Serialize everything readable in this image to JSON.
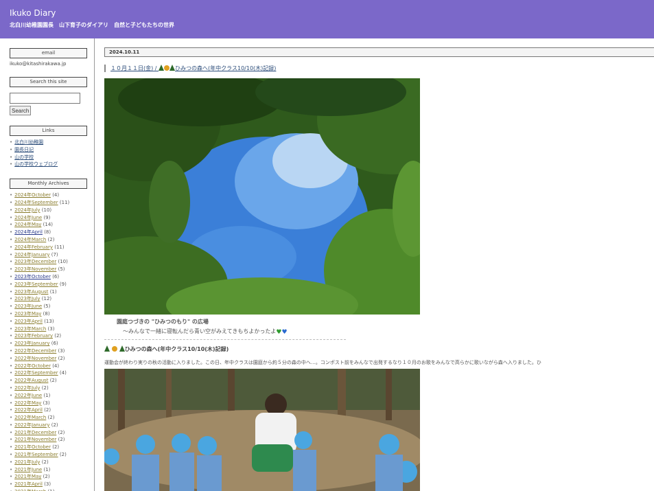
{
  "header": {
    "title": "Ikuko Diary",
    "description": "北白川幼稚園園長　山下育子のダイアリ　自然と子どもたちの世界"
  },
  "sidebar": {
    "email_title": "email",
    "email_value": "ikuko@kitashirakawa.jp",
    "search_title": "Search this site",
    "search_value": "",
    "search_button": "Search",
    "links_title": "Links",
    "links": [
      "北白川幼稚園",
      "園長日記",
      "山の学校",
      "山の学校ウェブログ"
    ],
    "archives_title": "Monthly Archives",
    "archives": [
      {
        "label": "2024年October",
        "count": "(4)"
      },
      {
        "label": "2024年September",
        "count": "(11)"
      },
      {
        "label": "2024年July",
        "count": "(10)"
      },
      {
        "label": "2024年June",
        "count": "(9)"
      },
      {
        "label": "2024年May",
        "count": "(14)"
      },
      {
        "label": "2024年April",
        "count": "(8)"
      },
      {
        "label": "2024年March",
        "count": "(2)"
      },
      {
        "label": "2024年February",
        "count": "(11)"
      },
      {
        "label": "2024年January",
        "count": "(7)"
      },
      {
        "label": "2023年December",
        "count": "(10)"
      },
      {
        "label": "2023年November",
        "count": "(5)"
      },
      {
        "label": "2023年October",
        "count": "(6)"
      },
      {
        "label": "2023年September",
        "count": "(9)"
      },
      {
        "label": "2023年August",
        "count": "(1)"
      },
      {
        "label": "2023年July",
        "count": "(12)"
      },
      {
        "label": "2023年June",
        "count": "(5)"
      },
      {
        "label": "2023年May",
        "count": "(8)"
      },
      {
        "label": "2023年April",
        "count": "(13)"
      },
      {
        "label": "2023年March",
        "count": "(3)"
      },
      {
        "label": "2023年February",
        "count": "(2)"
      },
      {
        "label": "2023年January",
        "count": "(6)"
      },
      {
        "label": "2022年December",
        "count": "(3)"
      },
      {
        "label": "2022年November",
        "count": "(2)"
      },
      {
        "label": "2022年October",
        "count": "(4)"
      },
      {
        "label": "2022年September",
        "count": "(4)"
      },
      {
        "label": "2022年August",
        "count": "(2)"
      },
      {
        "label": "2022年July",
        "count": "(2)"
      },
      {
        "label": "2022年June",
        "count": "(1)"
      },
      {
        "label": "2022年May",
        "count": "(3)"
      },
      {
        "label": "2022年April",
        "count": "(2)"
      },
      {
        "label": "2022年March",
        "count": "(2)"
      },
      {
        "label": "2022年January",
        "count": "(2)"
      },
      {
        "label": "2021年December",
        "count": "(2)"
      },
      {
        "label": "2021年November",
        "count": "(2)"
      },
      {
        "label": "2021年October",
        "count": "(2)"
      },
      {
        "label": "2021年September",
        "count": "(2)"
      },
      {
        "label": "2021年July",
        "count": "(2)"
      },
      {
        "label": "2021年June",
        "count": "(1)"
      },
      {
        "label": "2021年May",
        "count": "(2)"
      },
      {
        "label": "2021年April",
        "count": "(3)"
      },
      {
        "label": "2021年March",
        "count": "(1)"
      }
    ]
  },
  "main": {
    "date": "2024.10.11",
    "post_title": "１０月１１日(金) / ",
    "post_title_link": "ひみつの森へ(年中クラス10/10(木)記録)",
    "caption1": "園庭つづきの \"ひみつのもり\" の広場",
    "caption2": "〜みんなで一緒に寝転んだら青い空がみえてきもちよかったよ",
    "subheading": "ひみつの森へ(年中クラス10/10(木)記録)",
    "body": "運動会が終わり実りの秋の活動に入りました。この日、年中クラスは園庭から約５分の森の中へ…。コンポスト前をみんなで出発するなり１０月のお歌をみんなで高らかに歌いながら森へ入りました。ひ"
  },
  "icons": [
    "tree-icon",
    "flower-icon",
    "green-heart-icon",
    "blue-heart-icon"
  ],
  "colors": {
    "header_bg": "#7b68c9",
    "link": "#2c4d7a",
    "archive_link": "#8a7c2c"
  }
}
